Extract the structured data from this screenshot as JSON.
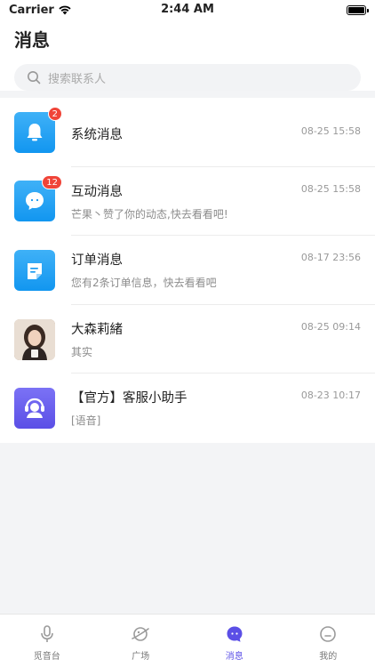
{
  "status": {
    "carrier": "Carrier",
    "time": "2:44 AM"
  },
  "header": {
    "title": "消息"
  },
  "search": {
    "placeholder": "搜索联系人"
  },
  "messages": [
    {
      "name": "系统消息",
      "preview": "",
      "time": "08-25 15:58",
      "badge": "2",
      "icon": "bell-icon"
    },
    {
      "name": "互动消息",
      "preview": "芒果丶赞了你的动态,快去看看吧!",
      "time": "08-25 15:58",
      "badge": "12",
      "icon": "chat-bubble-icon"
    },
    {
      "name": "订单消息",
      "preview": "您有2条订单信息，快去看看吧",
      "time": "08-17 23:56",
      "badge": "",
      "icon": "order-note-icon"
    },
    {
      "name": "大森莉緒",
      "preview": "其实",
      "time": "08-25 09:14",
      "badge": "",
      "icon": "user-photo-avatar"
    },
    {
      "name": "【官方】客服小助手",
      "preview": "[语音]",
      "time": "08-23 10:17",
      "badge": "",
      "icon": "headset-agent-icon"
    }
  ],
  "tabs": [
    {
      "label": "觅音台",
      "icon": "microphone-icon",
      "active": false
    },
    {
      "label": "广场",
      "icon": "planet-icon",
      "active": false
    },
    {
      "label": "消息",
      "icon": "message-icon",
      "active": true
    },
    {
      "label": "我的",
      "icon": "profile-face-icon",
      "active": false
    }
  ],
  "colors": {
    "accent": "#5b4fe6",
    "blue": "#1296f0",
    "badge": "#f04438"
  }
}
